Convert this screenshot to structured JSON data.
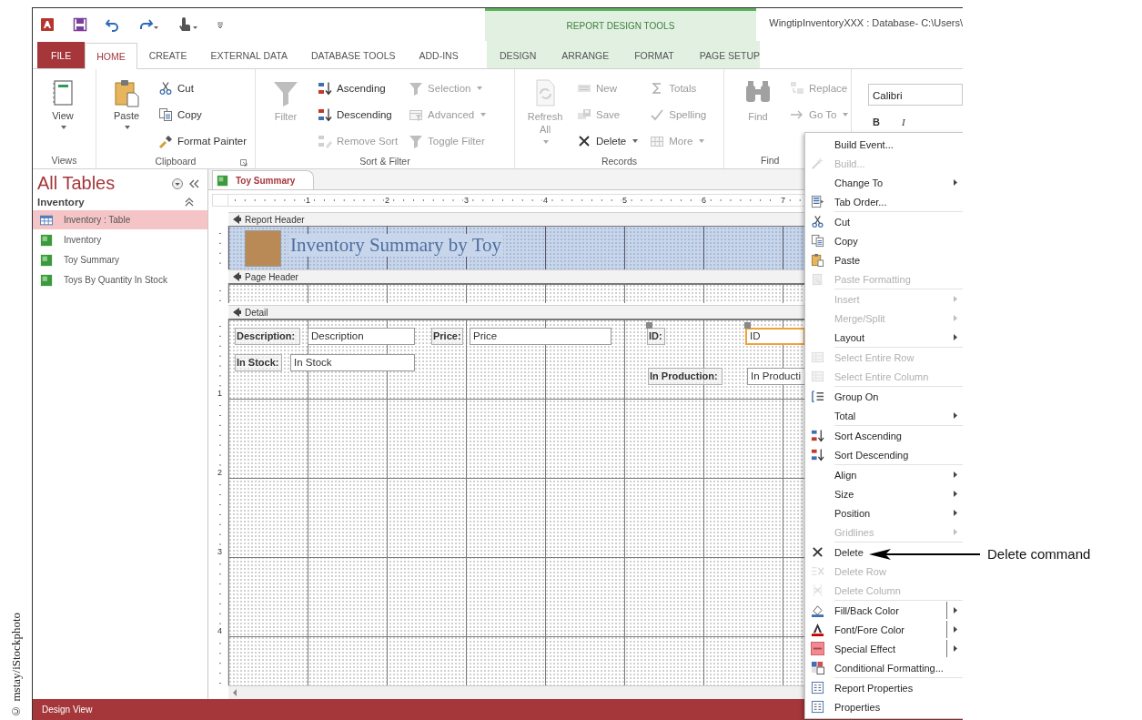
{
  "credit": "© mstay/iStockphoto",
  "title_bar": {
    "title": "WingtipInventoryXXX : Database- C:\\Users\\",
    "contextual_group": "REPORT DESIGN TOOLS"
  },
  "tabs": [
    {
      "label": "FILE",
      "kind": "file",
      "selected": false
    },
    {
      "label": "HOME",
      "kind": "main",
      "selected": true
    },
    {
      "label": "CREATE",
      "kind": "main",
      "selected": false
    },
    {
      "label": "EXTERNAL DATA",
      "kind": "main",
      "selected": false
    },
    {
      "label": "DATABASE TOOLS",
      "kind": "main",
      "selected": false
    },
    {
      "label": "ADD-INS",
      "kind": "main",
      "selected": false
    },
    {
      "label": "DESIGN",
      "kind": "contextual",
      "selected": false
    },
    {
      "label": "ARRANGE",
      "kind": "contextual",
      "selected": false
    },
    {
      "label": "FORMAT",
      "kind": "contextual",
      "selected": false
    },
    {
      "label": "PAGE SETUP",
      "kind": "contextual",
      "selected": false
    }
  ],
  "ribbon": {
    "groups": [
      {
        "label": "Views",
        "launcher": false,
        "columns": [
          [
            {
              "label": "View",
              "kind": "large",
              "disabled": false,
              "dropdown": true
            }
          ]
        ]
      },
      {
        "label": "Clipboard",
        "launcher": true,
        "columns": [
          [
            {
              "label": "Paste",
              "kind": "large",
              "disabled": false,
              "dropdown": true
            }
          ],
          [
            {
              "label": "Cut",
              "kind": "small",
              "disabled": false,
              "dropdown": false
            },
            {
              "label": "Copy",
              "kind": "small",
              "disabled": false,
              "dropdown": false
            },
            {
              "label": "Format Painter",
              "kind": "small",
              "disabled": false,
              "dropdown": false
            }
          ]
        ]
      },
      {
        "label": "Sort & Filter",
        "launcher": false,
        "columns": [
          [
            {
              "label": "Filter",
              "kind": "large",
              "disabled": true,
              "dropdown": false
            }
          ],
          [
            {
              "label": "Ascending",
              "kind": "small",
              "disabled": false,
              "dropdown": false
            },
            {
              "label": "Descending",
              "kind": "small",
              "disabled": false,
              "dropdown": false
            },
            {
              "label": "Remove Sort",
              "kind": "small",
              "disabled": true,
              "dropdown": false
            }
          ],
          [
            {
              "label": "Selection",
              "kind": "small",
              "disabled": true,
              "dropdown": true
            },
            {
              "label": "Advanced",
              "kind": "small",
              "disabled": true,
              "dropdown": true
            },
            {
              "label": "Toggle Filter",
              "kind": "small",
              "disabled": true,
              "dropdown": false
            }
          ]
        ]
      },
      {
        "label": "Records",
        "launcher": false,
        "columns": [
          [
            {
              "label": "Refresh All",
              "kind": "large",
              "disabled": true,
              "dropdown": true
            }
          ],
          [
            {
              "label": "New",
              "kind": "small",
              "disabled": true,
              "dropdown": false
            },
            {
              "label": "Save",
              "kind": "small",
              "disabled": true,
              "dropdown": false
            },
            {
              "label": "Delete",
              "kind": "small",
              "disabled": false,
              "dropdown": true
            }
          ],
          [
            {
              "label": "Totals",
              "kind": "small",
              "disabled": true,
              "dropdown": false
            },
            {
              "label": "Spelling",
              "kind": "small",
              "disabled": true,
              "dropdown": false
            },
            {
              "label": "More",
              "kind": "small",
              "disabled": true,
              "dropdown": true
            }
          ]
        ]
      },
      {
        "label": "Find",
        "launcher": false,
        "columns": [
          [
            {
              "label": "Find",
              "kind": "large",
              "disabled": true,
              "dropdown": false
            }
          ],
          [
            {
              "label": "Replace",
              "kind": "small",
              "disabled": true,
              "dropdown": false
            },
            {
              "label": "Go To",
              "kind": "small",
              "disabled": true,
              "dropdown": true
            }
          ]
        ]
      }
    ],
    "font": {
      "value": "Calibri",
      "bold": "B",
      "italic": "I"
    }
  },
  "navigation": {
    "title": "All Tables",
    "group": {
      "label": "Inventory",
      "expanded": true
    },
    "items": [
      {
        "label": "Inventory : Table",
        "kind": "table",
        "selected": true
      },
      {
        "label": "Inventory",
        "kind": "report",
        "selected": false
      },
      {
        "label": "Toy Summary",
        "kind": "report",
        "selected": false
      },
      {
        "label": "Toys By Quantity In Stock",
        "kind": "report",
        "selected": false
      }
    ]
  },
  "document": {
    "tab": "Toy Summary",
    "ruler": [
      "1",
      "2",
      "3",
      "4",
      "5",
      "6",
      "7"
    ],
    "sections": [
      {
        "label": "Report Header",
        "kind": "report_header",
        "title": "Inventory Summary by Toy"
      },
      {
        "label": "Page Header",
        "kind": "page_header"
      },
      {
        "label": "Detail",
        "kind": "detail",
        "ruler": [
          "1",
          "2",
          "3",
          "4"
        ],
        "controls": [
          {
            "text": "Description:",
            "kind": "label",
            "selected": false,
            "move_handle": false
          },
          {
            "text": "Description",
            "kind": "textbox",
            "selected": false,
            "move_handle": false
          },
          {
            "text": "Price:",
            "kind": "label",
            "selected": false,
            "move_handle": false
          },
          {
            "text": "Price",
            "kind": "textbox",
            "selected": false,
            "move_handle": false
          },
          {
            "text": "ID:",
            "kind": "label",
            "selected": false,
            "move_handle": true
          },
          {
            "text": "ID",
            "kind": "textbox",
            "selected": true,
            "move_handle": true
          },
          {
            "text": "In Stock:",
            "kind": "label",
            "selected": false,
            "move_handle": false
          },
          {
            "text": "In Stock",
            "kind": "textbox",
            "selected": false,
            "move_handle": false
          },
          {
            "text": "In Production:",
            "kind": "label",
            "selected": false,
            "move_handle": false
          },
          {
            "text": "In Producti",
            "kind": "textbox",
            "selected": false,
            "move_handle": false
          }
        ]
      }
    ]
  },
  "context_menu": {
    "groups": [
      [
        {
          "label": "Build Event...",
          "disabled": false,
          "kind": "plain"
        },
        {
          "label": "Build...",
          "disabled": true,
          "kind": "plain"
        },
        {
          "label": "Change To",
          "disabled": false,
          "kind": "submenu"
        },
        {
          "label": "Tab Order...",
          "disabled": false,
          "kind": "plain"
        }
      ],
      [
        {
          "label": "Cut",
          "disabled": false,
          "kind": "plain"
        },
        {
          "label": "Copy",
          "disabled": false,
          "kind": "plain"
        },
        {
          "label": "Paste",
          "disabled": false,
          "kind": "plain"
        },
        {
          "label": "Paste Formatting",
          "disabled": true,
          "kind": "plain"
        }
      ],
      [
        {
          "label": "Insert",
          "disabled": true,
          "kind": "submenu"
        },
        {
          "label": "Merge/Split",
          "disabled": true,
          "kind": "submenu"
        },
        {
          "label": "Layout",
          "disabled": false,
          "kind": "submenu"
        }
      ],
      [
        {
          "label": "Select Entire Row",
          "disabled": true,
          "kind": "plain"
        },
        {
          "label": "Select Entire Column",
          "disabled": true,
          "kind": "plain"
        }
      ],
      [
        {
          "label": "Group On",
          "disabled": false,
          "kind": "plain"
        },
        {
          "label": "Total",
          "disabled": false,
          "kind": "submenu"
        }
      ],
      [
        {
          "label": "Sort Ascending",
          "disabled": false,
          "kind": "plain"
        },
        {
          "label": "Sort Descending",
          "disabled": false,
          "kind": "plain"
        }
      ],
      [
        {
          "label": "Align",
          "disabled": false,
          "kind": "submenu"
        },
        {
          "label": "Size",
          "disabled": false,
          "kind": "submenu"
        },
        {
          "label": "Position",
          "disabled": false,
          "kind": "submenu"
        },
        {
          "label": "Gridlines",
          "disabled": true,
          "kind": "submenu"
        }
      ],
      [
        {
          "label": "Delete",
          "disabled": false,
          "kind": "plain"
        },
        {
          "label": "Delete Row",
          "disabled": true,
          "kind": "plain"
        },
        {
          "label": "Delete Column",
          "disabled": true,
          "kind": "plain"
        }
      ],
      [
        {
          "label": "Fill/Back Color",
          "disabled": false,
          "kind": "split"
        },
        {
          "label": "Font/Fore Color",
          "disabled": false,
          "kind": "split"
        },
        {
          "label": "Special Effect",
          "disabled": false,
          "kind": "split"
        },
        {
          "label": "Conditional Formatting...",
          "disabled": false,
          "kind": "plain"
        }
      ],
      [
        {
          "label": "Report Properties",
          "disabled": false,
          "kind": "plain"
        },
        {
          "label": "Properties",
          "disabled": false,
          "kind": "plain"
        }
      ]
    ]
  },
  "status_bar": {
    "text": "Design View"
  },
  "callout": {
    "text": "Delete command"
  }
}
